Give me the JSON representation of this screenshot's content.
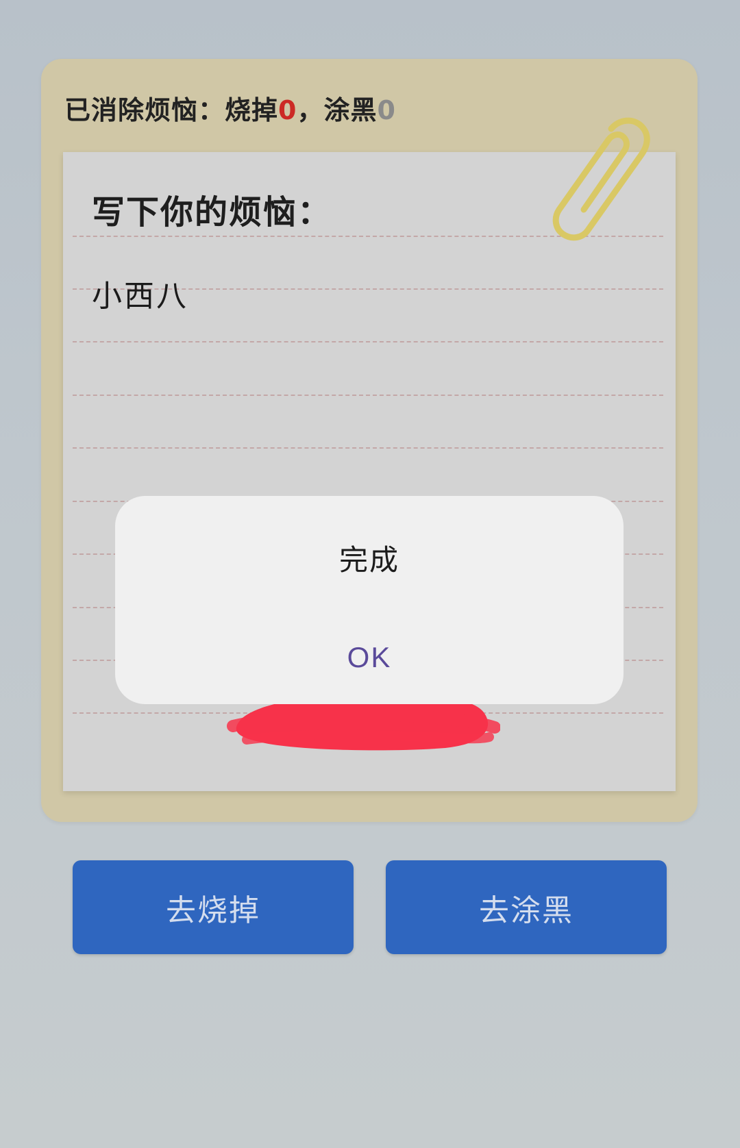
{
  "counter": {
    "prefix": "已消除烦恼：烧掉",
    "burn_count": "0",
    "separator": "，涂黑",
    "blacken_count": "0"
  },
  "paper": {
    "title": "写下你的烦恼：",
    "entry_text": "小西八"
  },
  "dialog": {
    "title": "完成",
    "ok_label": "OK"
  },
  "actions": {
    "burn_label": "去烧掉",
    "blacken_label": "去涂黑"
  },
  "colors": {
    "card_bg": "#d0c7a6",
    "paper_bg": "#d3d3d3",
    "burn_count_color": "#cc2a25",
    "blacken_count_color": "#8a8a8a",
    "button_bg": "#2f66bf",
    "ok_color": "#5a4a9a",
    "scribble_color": "#f7324a",
    "paperclip_color": "#d9c865"
  },
  "icons": {
    "paperclip": "paperclip-icon"
  }
}
